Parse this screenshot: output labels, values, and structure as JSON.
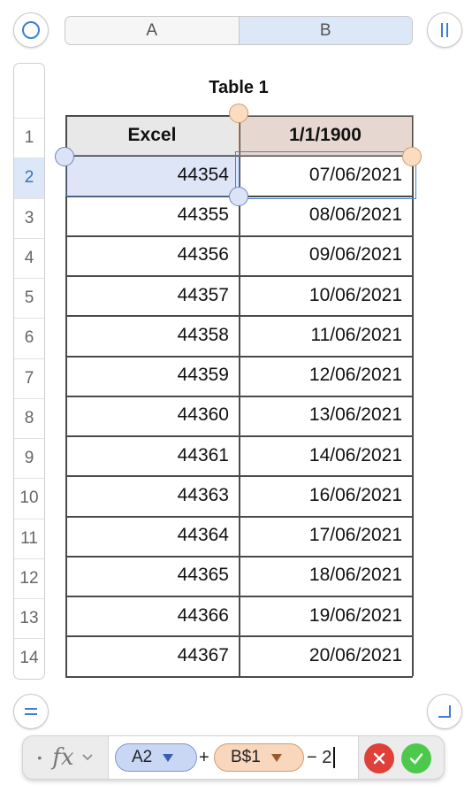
{
  "columns": {
    "a_label": "A",
    "b_label": "B"
  },
  "rows": [
    "1",
    "2",
    "3",
    "4",
    "5",
    "6",
    "7",
    "8",
    "9",
    "10",
    "11",
    "12",
    "13",
    "14"
  ],
  "table": {
    "title": "Table 1",
    "header": [
      "Excel",
      "1/1/1900"
    ],
    "data": [
      [
        "44354",
        "07/06/2021"
      ],
      [
        "44355",
        "08/06/2021"
      ],
      [
        "44356",
        "09/06/2021"
      ],
      [
        "44357",
        "10/06/2021"
      ],
      [
        "44358",
        "11/06/2021"
      ],
      [
        "44359",
        "12/06/2021"
      ],
      [
        "44360",
        "13/06/2021"
      ],
      [
        "44361",
        "14/06/2021"
      ],
      [
        "44363",
        "16/06/2021"
      ],
      [
        "44364",
        "17/06/2021"
      ],
      [
        "44365",
        "18/06/2021"
      ],
      [
        "44366",
        "19/06/2021"
      ],
      [
        "44367",
        "20/06/2021"
      ]
    ],
    "selected_row": "2",
    "selected_cell": "A2"
  },
  "formula": {
    "fx_label": "fx",
    "token_1": "A2",
    "op_plus": "+",
    "token_2": "B$1",
    "suffix": "− 2"
  },
  "colors": {
    "selection_blue": "#dce8f8",
    "ref_blue": "#c9d7f5",
    "ref_orange": "#f8d7bd",
    "header_gray": "#e8e8e8",
    "header_tan": "#e6d8d0",
    "cancel_red": "#e0403a",
    "accept_green": "#4cc94a"
  },
  "icons": {
    "top_left": "circle-icon",
    "top_right": "pause-bars-icon",
    "bottom_left": "equals-icon",
    "bottom_right": "resize-corner-icon",
    "cancel": "x-icon",
    "accept": "checkmark-icon"
  }
}
